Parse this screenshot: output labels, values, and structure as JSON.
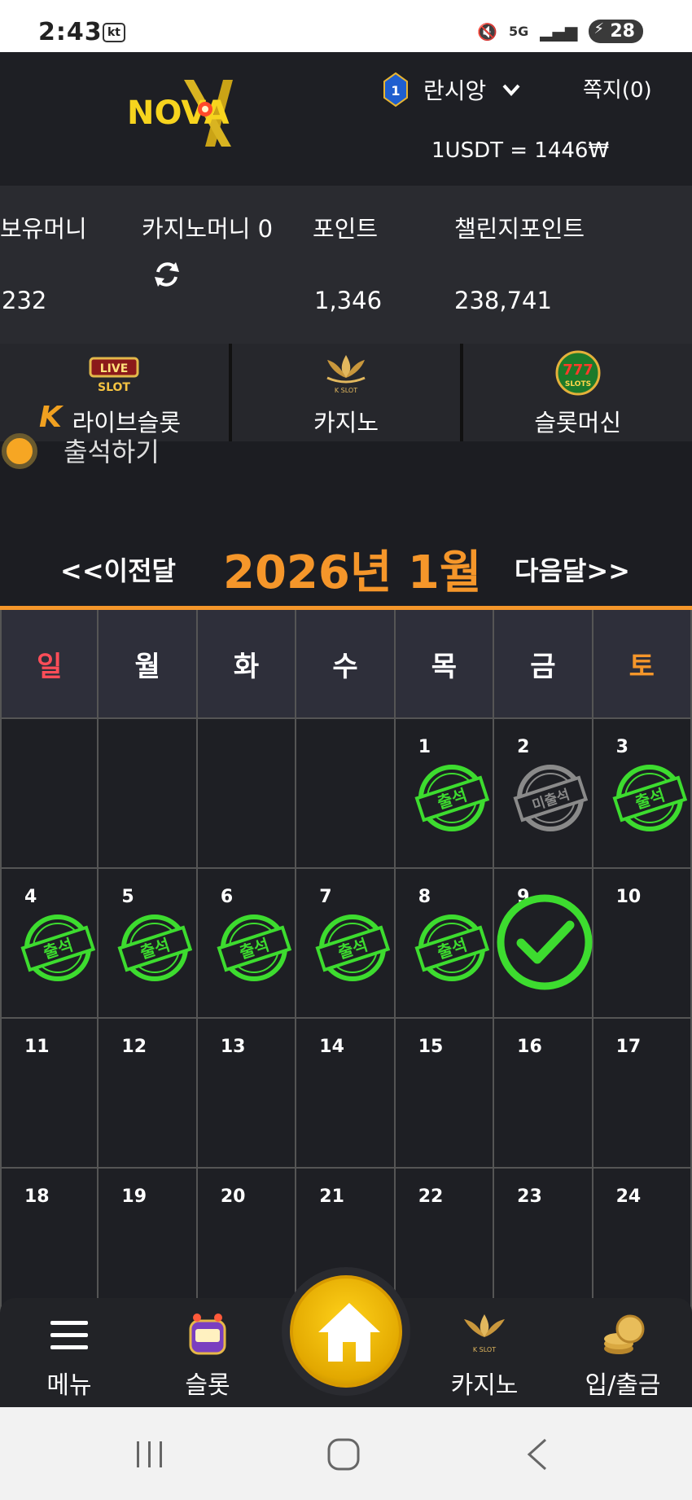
{
  "status_bar": {
    "time": "2:43",
    "carrier": "kt",
    "network": "5G",
    "battery": "28"
  },
  "header": {
    "logo_text": "NOVA",
    "level": "1",
    "username": "란시앙",
    "messages": "쪽지(0)",
    "exchange_rate": "1USDT = 1446₩"
  },
  "balance": {
    "hold_label": "보유머니",
    "hold_value": "232",
    "casino_label": "카지노머니 0",
    "point_label": "포인트",
    "point_value": "1,346",
    "challenge_label": "챌린지포인트",
    "challenge_value": "238,741"
  },
  "games": [
    {
      "label": "라이브슬롯",
      "icon": "live-slot-icon",
      "badge": "K",
      "sub": "LIVE",
      "sub2": "SLOT"
    },
    {
      "label": "카지노",
      "icon": "k-slot-icon",
      "sub": "K SLOT"
    },
    {
      "label": "슬롯머신",
      "icon": "777-slots-icon",
      "sub": "777",
      "sub2": "SLOTS"
    }
  ],
  "attendance": {
    "label": "출석하기"
  },
  "calendar": {
    "prev": "<<이전달",
    "title": "2026년 1월",
    "next": "다음달>>",
    "weekdays": [
      "일",
      "월",
      "화",
      "수",
      "목",
      "금",
      "토"
    ],
    "stamp_present": "출석",
    "stamp_absent": "미출석",
    "days": [
      {
        "n": "",
        "s": ""
      },
      {
        "n": "",
        "s": ""
      },
      {
        "n": "",
        "s": ""
      },
      {
        "n": "",
        "s": ""
      },
      {
        "n": "1",
        "s": "present"
      },
      {
        "n": "2",
        "s": "absent"
      },
      {
        "n": "3",
        "s": "present"
      },
      {
        "n": "4",
        "s": "present"
      },
      {
        "n": "5",
        "s": "present"
      },
      {
        "n": "6",
        "s": "present"
      },
      {
        "n": "7",
        "s": "present"
      },
      {
        "n": "8",
        "s": "present"
      },
      {
        "n": "9",
        "s": "today"
      },
      {
        "n": "10",
        "s": ""
      },
      {
        "n": "11",
        "s": ""
      },
      {
        "n": "12",
        "s": ""
      },
      {
        "n": "13",
        "s": ""
      },
      {
        "n": "14",
        "s": ""
      },
      {
        "n": "15",
        "s": ""
      },
      {
        "n": "16",
        "s": ""
      },
      {
        "n": "17",
        "s": ""
      },
      {
        "n": "18",
        "s": ""
      },
      {
        "n": "19",
        "s": ""
      },
      {
        "n": "20",
        "s": ""
      },
      {
        "n": "21",
        "s": ""
      },
      {
        "n": "22",
        "s": ""
      },
      {
        "n": "23",
        "s": ""
      },
      {
        "n": "24",
        "s": ""
      }
    ]
  },
  "bottom_nav": {
    "menu": "메뉴",
    "slot": "슬롯",
    "casino": "카지노",
    "deposit": "입/출금",
    "casino_icon_text": "K SLOT"
  },
  "colors": {
    "accent": "#f5962a",
    "stamp_green": "#3ddc2f",
    "sunday": "#ff4d58"
  }
}
